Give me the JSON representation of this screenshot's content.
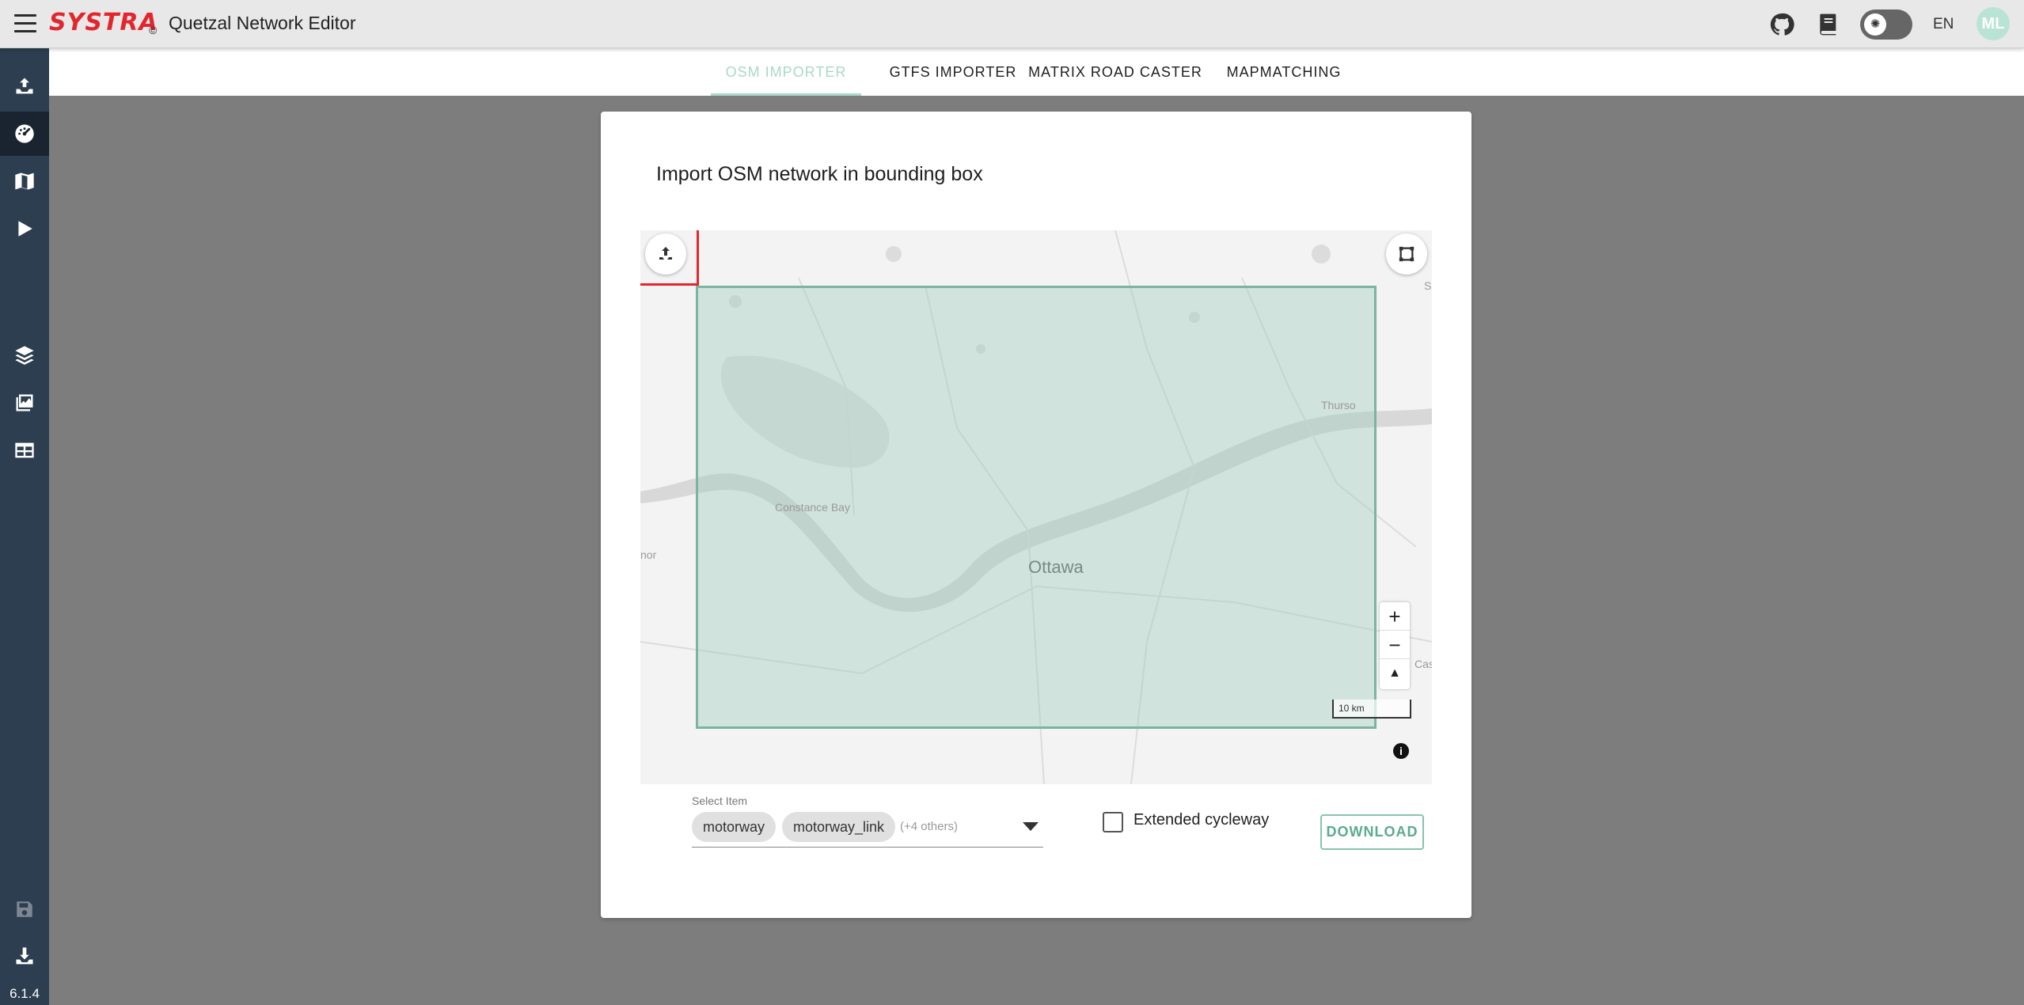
{
  "header": {
    "logo": "SYSTRA",
    "logo_mark": "©",
    "title": "Quetzal Network Editor",
    "lang": "EN",
    "avatar": "ML"
  },
  "sidebar": {
    "items": [
      {
        "name": "import-icon"
      },
      {
        "name": "dashboard-icon",
        "active": true
      },
      {
        "name": "map-icon"
      },
      {
        "name": "run-icon"
      },
      {
        "name": "layers-icon"
      },
      {
        "name": "gallery-icon"
      },
      {
        "name": "table-icon"
      },
      {
        "name": "save-icon"
      },
      {
        "name": "download-icon"
      }
    ],
    "version": "6.1.4"
  },
  "tabs": [
    {
      "label": "OSM IMPORTER",
      "active": true
    },
    {
      "label": "GTFS IMPORTER"
    },
    {
      "label": "MATRIX ROAD CASTER"
    },
    {
      "label": "MAPMATCHING"
    }
  ],
  "card": {
    "title": "Import OSM network in bounding box"
  },
  "map": {
    "labels": {
      "city": "Ottawa",
      "constance": "Constance Bay",
      "thurso": "Thurso",
      "cas": "Cas",
      "nor": "nor",
      "s": "S"
    },
    "scale": "10 km",
    "zoom_in": "+",
    "zoom_out": "−",
    "compass": "▲",
    "info": "i"
  },
  "form": {
    "select_label": "Select Item",
    "chips": [
      "motorway",
      "motorway_link"
    ],
    "others": "(+4 others)",
    "checkbox_label": "Extended cycleway",
    "download_label": "DOWNLOAD"
  },
  "colors": {
    "brand_red": "#e3262e",
    "sidebar": "#2d3e50",
    "accent": "#a9d9c8",
    "bbox_fill": "#a0cebd",
    "download": "#5cab8e"
  }
}
